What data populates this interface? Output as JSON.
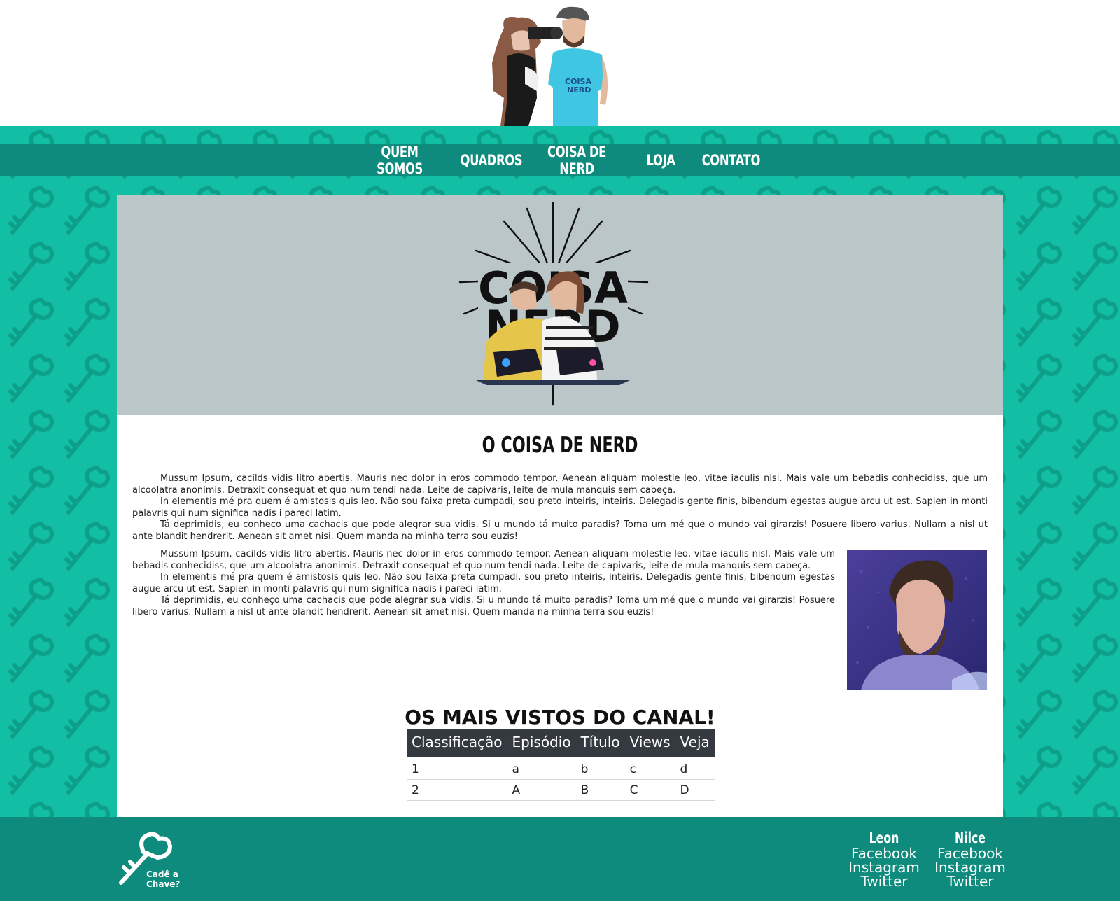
{
  "nav": {
    "items": [
      "QUEM SOMOS",
      "QUADROS",
      "COISA DE NERD",
      "LOJA",
      "CONTATO"
    ]
  },
  "section": {
    "title": "O COISA DE NERD"
  },
  "article_top": {
    "paragraphs": [
      "Mussum Ipsum, cacilds vidis litro abertis. Mauris nec dolor in eros commodo tempor. Aenean aliquam molestie leo, vitae iaculis nisl. Mais vale um bebadis conhecidiss, que um alcoolatra anonimis. Detraxit consequat et quo num tendi nada. Leite de capivaris, leite de mula manquis sem cabeça.",
      "In elementis mé pra quem é amistosis quis leo. Não sou faixa preta cumpadi, sou preto inteiris, inteiris. Delegadis gente finis, bibendum egestas augue arcu ut est. Sapien in monti palavris qui num significa nadis i pareci latim.",
      "Tá deprimidis, eu conheço uma cachacis que pode alegrar sua vidis. Si u mundo tá muito paradis? Toma um mé que o mundo vai girarzis! Posuere libero varius. Nullam a nisl ut ante blandit hendrerit. Aenean sit amet nisi. Quem manda na minha terra sou euzis!"
    ]
  },
  "article_bottom": {
    "paragraphs": [
      "Mussum Ipsum, cacilds vidis litro abertis. Mauris nec dolor in eros commodo tempor. Aenean aliquam molestie leo, vitae iaculis nisl. Mais vale um bebadis conhecidiss, que um alcoolatra anonimis. Detraxit consequat et quo num tendi nada. Leite de capivaris, leite de mula manquis sem cabeça.",
      "In elementis mé pra quem é amistosis quis leo. Não sou faixa preta cumpadi, sou preto inteiris, inteiris. Delegadis gente finis, bibendum egestas augue arcu ut est. Sapien in monti palavris qui num significa nadis i pareci latim.",
      "Tá deprimidis, eu conheço uma cachacis que pode alegrar sua vidis. Si u mundo tá muito paradis? Toma um mé que o mundo vai girarzis! Posuere libero varius. Nullam a nisl ut ante blandit hendrerit. Aenean sit amet nisi. Quem manda na minha terra sou euzis!"
    ]
  },
  "table": {
    "title": "OS MAIS VISTOS DO CANAL!",
    "headers": [
      "Classificação",
      "Episódio",
      "Título",
      "Views",
      "Veja"
    ],
    "rows": [
      [
        "1",
        "a",
        "b",
        "c",
        "d"
      ],
      [
        "2",
        "A",
        "B",
        "C",
        "D"
      ]
    ]
  },
  "footer": {
    "logo_text_line1": "Cadê a",
    "logo_text_line2": "Chave?",
    "socials": [
      {
        "name": "Leon",
        "links": [
          "Facebook",
          "Instagram",
          "Twitter"
        ]
      },
      {
        "name": "Nilce",
        "links": [
          "Facebook",
          "Instagram",
          "Twitter"
        ]
      }
    ]
  },
  "colors": {
    "teal": "#12bfa4",
    "dark_teal": "#0e8b7c",
    "banner_gray": "#bbc6c8",
    "table_header": "#343a40"
  },
  "logo_letters": {
    "top": "COISA",
    "bottom": "NERD"
  }
}
